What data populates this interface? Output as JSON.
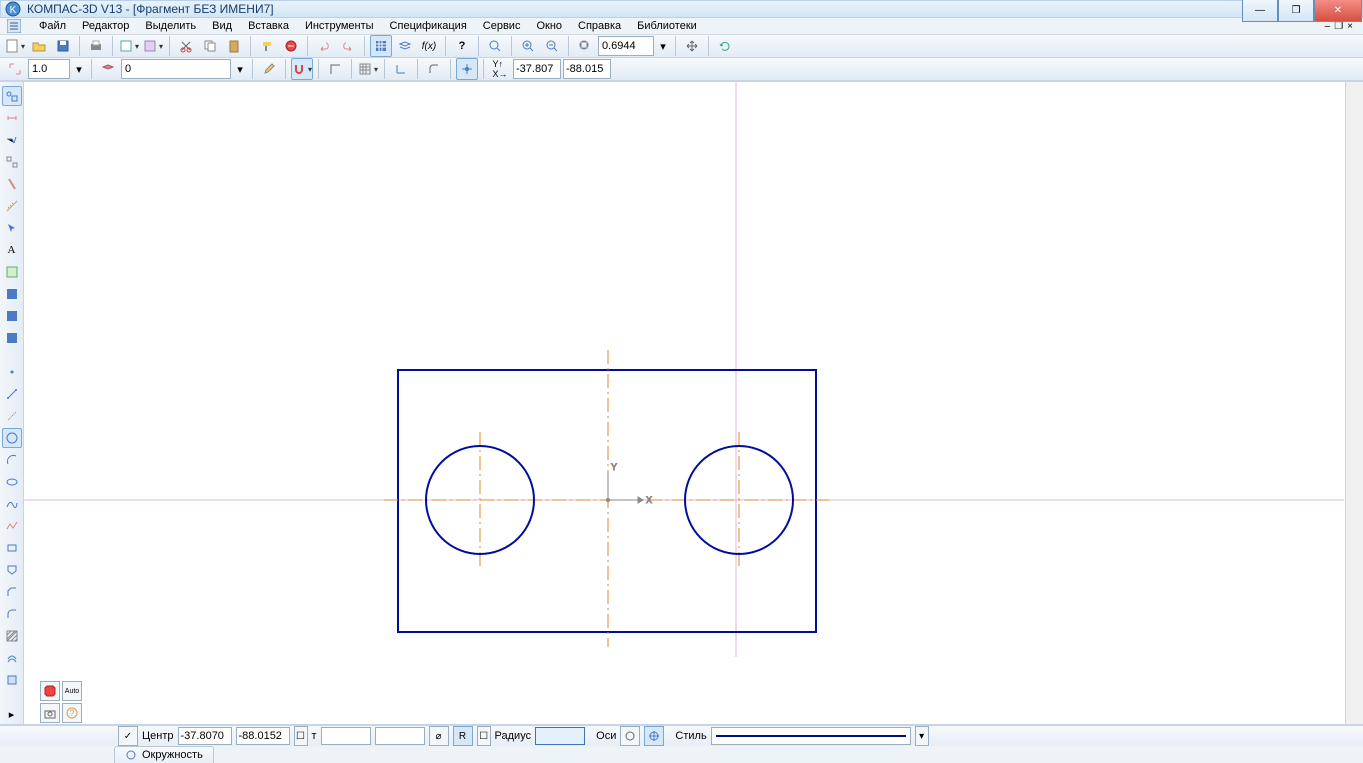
{
  "window": {
    "title": "КОМПАС-3D V13 - [Фрагмент БЕЗ ИМЕНИ7]"
  },
  "menu": {
    "items": [
      "Файл",
      "Редактор",
      "Выделить",
      "Вид",
      "Вставка",
      "Инструменты",
      "Спецификация",
      "Сервис",
      "Окно",
      "Справка",
      "Библиотеки"
    ]
  },
  "toolbar1": {
    "zoom_value": "0.6944"
  },
  "toolbar2": {
    "scale": "1.0",
    "layer": "0",
    "coord_x": "-37.807",
    "coord_y": "-88.015"
  },
  "params": {
    "center_label": "Центр",
    "center_x": "-37.8070",
    "center_y": "-88.0152",
    "t_label": "т",
    "t_val1": "",
    "t_val2": "",
    "r_label": "R",
    "radius_label": "Радиус",
    "radius_val": "",
    "axes_label": "Оси",
    "style_label": "Стиль"
  },
  "tab": {
    "label": "Окружность"
  }
}
